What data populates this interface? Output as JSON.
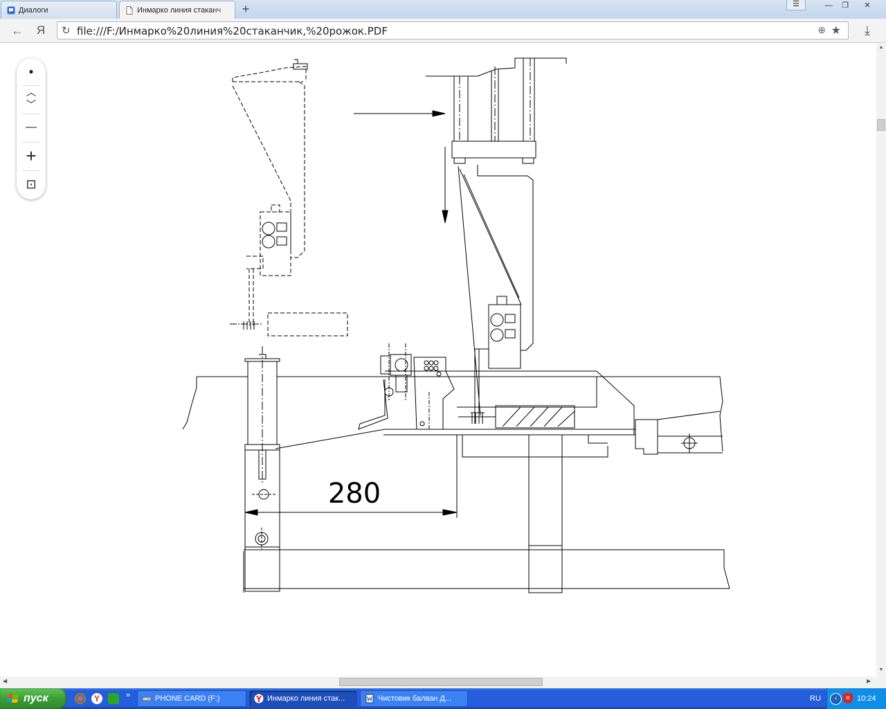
{
  "tabs": [
    {
      "label": "Диалоги",
      "active": false
    },
    {
      "label": "Инмарко линия стаканч",
      "active": true
    }
  ],
  "new_tab": "+",
  "window_controls": {
    "menu": "☰",
    "minimize": "—",
    "restore": "❐",
    "close": "✕"
  },
  "nav": {
    "back": "←",
    "yandex": "Я",
    "download": "⤓"
  },
  "address": {
    "reload": "↻",
    "url": "file:///F:/Инмарко%20линия%20стаканчик,%20рожок.PDF",
    "zoom": "⊕",
    "star": "★"
  },
  "toolbar": {
    "dot": "●",
    "up": "︿",
    "down": "﹀",
    "zoom_out": "—",
    "zoom_in": "+",
    "fit": "⊡"
  },
  "drawing": {
    "dimension": "280"
  },
  "taskbar": {
    "start_label": "пуск",
    "quick_launch_more": "»",
    "items": [
      {
        "label": "PHONE CARD (F:)",
        "active": false
      },
      {
        "label": "Инмарко линия стак...",
        "active": true
      },
      {
        "label": "Чистовик балван Д...",
        "active": false
      }
    ],
    "language": "RU",
    "time": "10:24"
  },
  "colors": {
    "taskbar": "#245edb",
    "start": "#3a9e36",
    "tray": "#0f8ee8",
    "tabstrip": "#c4d6ec"
  }
}
